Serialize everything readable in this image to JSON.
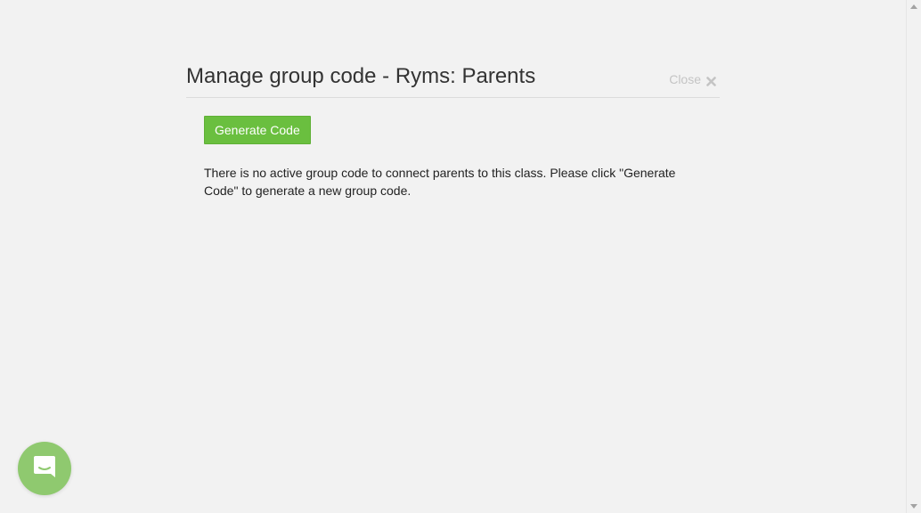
{
  "modal": {
    "title": "Manage group code - Ryms: Parents",
    "close_label": "Close",
    "close_icon": "close-x-icon",
    "generate_button_label": "Generate Code",
    "message": "There is no active group code to connect parents to this class. Please click \"Generate Code\" to generate a new group code."
  },
  "chat": {
    "icon": "chat-bubble-icon"
  },
  "colors": {
    "background": "#f2f2f2",
    "generate_button": "#6abf3f",
    "chat_launcher": "#8fc96f",
    "close_text": "#c4c4c4"
  }
}
